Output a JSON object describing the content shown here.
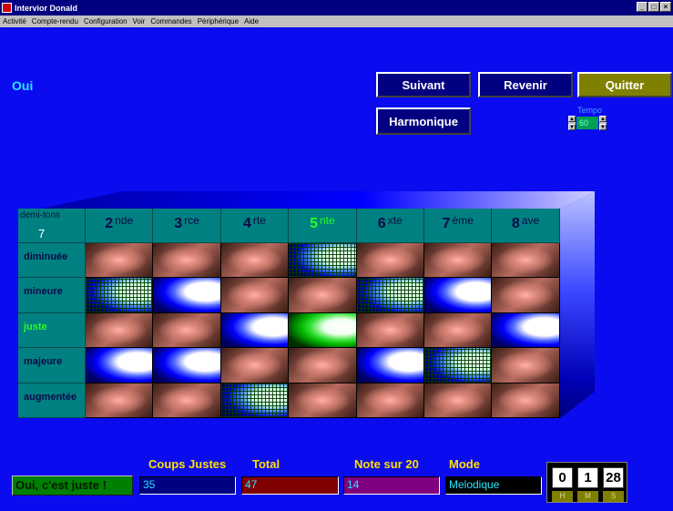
{
  "window": {
    "title": "Intervior  Donald",
    "controls": [
      "_",
      "□",
      "×"
    ]
  },
  "menu": [
    "Activité",
    "Compte-rendu",
    "Configuration",
    "Voir",
    "Commandes",
    "Périphérique",
    "Aide"
  ],
  "status_top": "Oui",
  "buttons": {
    "next": "Suivant",
    "back": "Revenir",
    "quit": "Quitter",
    "harmonic": "Harmonique"
  },
  "tempo": {
    "label": "Tempo",
    "value": "60"
  },
  "grid": {
    "corner_label": "demi-tons",
    "corner_value": "7",
    "columns": [
      {
        "num": "2",
        "suffix": "nde"
      },
      {
        "num": "3",
        "suffix": "rce"
      },
      {
        "num": "4",
        "suffix": "rte"
      },
      {
        "num": "5",
        "suffix": "nte"
      },
      {
        "num": "6",
        "suffix": "xte"
      },
      {
        "num": "7",
        "suffix": "ème"
      },
      {
        "num": "8",
        "suffix": "ave"
      }
    ],
    "rows": [
      "diminuée",
      "mineure",
      "juste",
      "majeure",
      "augmentée"
    ],
    "active_column": 3,
    "active_row": 2,
    "cells": [
      [
        "pyr",
        "pyr",
        "pyr",
        "gridc",
        "pyr",
        "pyr",
        "pyr"
      ],
      [
        "gridc",
        "blue",
        "pyr",
        "pyr",
        "gridc",
        "blue",
        "pyr"
      ],
      [
        "pyr",
        "pyr",
        "blue",
        "green",
        "pyr",
        "pyr",
        "blue"
      ],
      [
        "blue",
        "blue",
        "pyr",
        "pyr",
        "blue",
        "gridc",
        "pyr"
      ],
      [
        "pyr",
        "pyr",
        "gridc",
        "pyr",
        "pyr",
        "pyr",
        "pyr"
      ]
    ]
  },
  "feedback": "Oui, c'est juste !",
  "stats": {
    "coups_justes": {
      "label": "Coups Justes",
      "value": "35",
      "color": "#000080"
    },
    "total": {
      "label": "Total",
      "value": "47",
      "color": "#800000"
    },
    "note": {
      "label": "Note sur  20",
      "value": "14",
      "color": "#800080"
    },
    "mode": {
      "label": "Mode",
      "value": "Melodique",
      "color": "#000000"
    }
  },
  "timer": {
    "h": "0",
    "m": "1",
    "s": "28",
    "h_label": "H",
    "m_label": "M",
    "s_label": "S"
  }
}
